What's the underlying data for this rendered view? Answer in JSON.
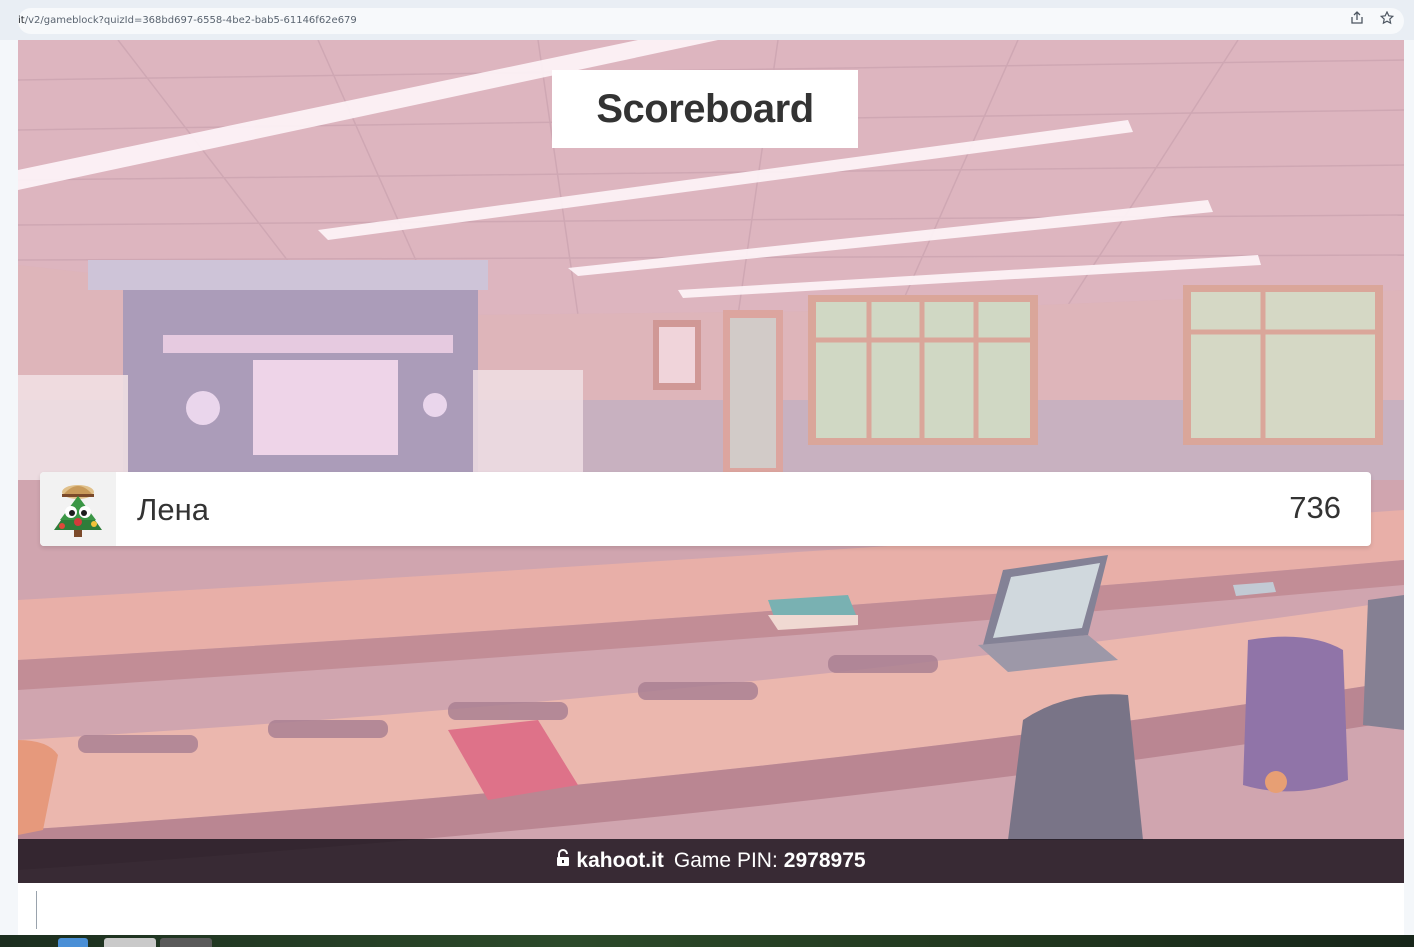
{
  "browser": {
    "url_host": "it",
    "url_path": "/v2/gameblock?quizId=368bd697-6558-4be2-bab5-61146f62e679",
    "share_icon": "share-icon",
    "bookmark_icon": "star-icon"
  },
  "game": {
    "title": "Scoreboard",
    "players": [
      {
        "name": "Лена",
        "score": "736",
        "avatar": "tree-monster-avatar-icon"
      }
    ],
    "footer": {
      "lock_icon": "lock-icon",
      "site": "kahoot.it",
      "pin_label": "Game PIN:",
      "pin_value": "2978975"
    }
  },
  "colors": {
    "title_bg": "#ffffff",
    "title_text": "#333333",
    "pin_bar_bg": "#1e1620",
    "scene_pink": "#d7aab4"
  }
}
